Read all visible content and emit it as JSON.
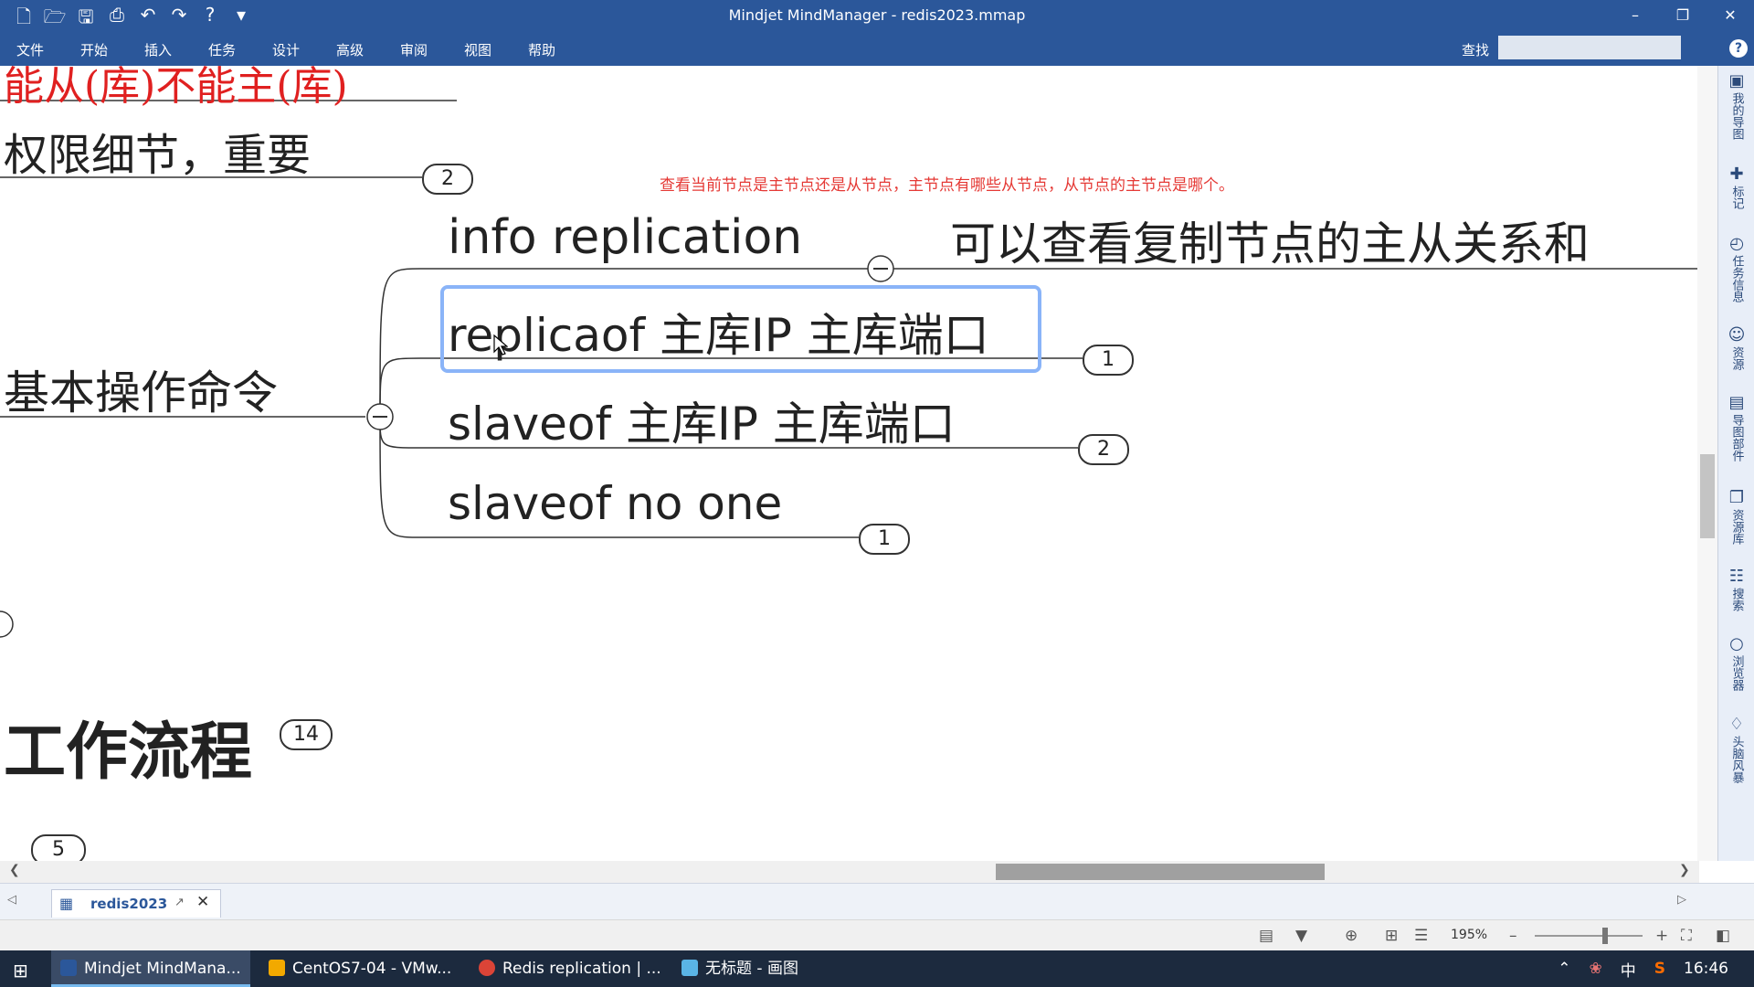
{
  "window": {
    "title": "Mindjet MindManager - redis2023.mmap",
    "controls": {
      "minimize": "–",
      "restore": "❐",
      "close": "✕"
    }
  },
  "qat": {
    "icons": [
      "new-icon",
      "open-icon",
      "save-icon",
      "print-icon",
      "undo-icon",
      "redo-icon",
      "help-frame-icon",
      "customize-icon"
    ]
  },
  "menu": {
    "items": [
      "文件",
      "开始",
      "插入",
      "任务",
      "设计",
      "高级",
      "审阅",
      "视图",
      "帮助"
    ],
    "find_label": "查找"
  },
  "map": {
    "red_node": "能从(库)不能主(库)",
    "perm_node": "权限细节，重要",
    "perm_badge": "2",
    "basic_node": "基本操作命令",
    "note": "查看当前节点是主节点还是从节点，主节点有哪些从节点，从节点的主节点是哪个。",
    "info_node": "info replication",
    "desc_node": "可以查看复制节点的主从关系和",
    "replicaof_node": "replicaof 主库IP 主库端口",
    "replicaof_badge": "1",
    "slaveof_node": "slaveof 主库IP 主库端口",
    "slaveof_badge": "2",
    "slaveof_no_one": "slaveof no one",
    "slaveof_no_one_badge": "1",
    "workflow_node": "工作流程",
    "workflow_badge": "14",
    "bottom_badge": "5"
  },
  "task_pane": {
    "items": [
      {
        "icon": "my-maps-icon",
        "label": "我的导图"
      },
      {
        "icon": "markers-icon",
        "label": "标记"
      },
      {
        "icon": "task-info-icon",
        "label": "任务信息"
      },
      {
        "icon": "resources-icon",
        "label": "资源"
      },
      {
        "icon": "map-parts-icon",
        "label": "导图部件"
      },
      {
        "icon": "library-icon",
        "label": "资源库"
      },
      {
        "icon": "search-icon",
        "label": "搜索"
      },
      {
        "icon": "browser-icon",
        "label": "浏览器"
      },
      {
        "icon": "brainstorm-icon",
        "label": "头脑风暴"
      }
    ]
  },
  "doc_tab": {
    "name": "redis2023"
  },
  "status": {
    "zoom": "195%"
  },
  "taskbar": {
    "apps": [
      {
        "label": "Mindjet MindMana...",
        "color": "#2b579a",
        "active": true
      },
      {
        "label": "CentOS7-04 - VMw...",
        "color": "#f2a900",
        "active": false
      },
      {
        "label": "Redis replication | ...",
        "color": "#db4437",
        "active": false
      },
      {
        "label": "无标题 - 画图",
        "color": "#5ab4e5",
        "active": false
      }
    ],
    "ime": "中",
    "clock": "16:46"
  }
}
